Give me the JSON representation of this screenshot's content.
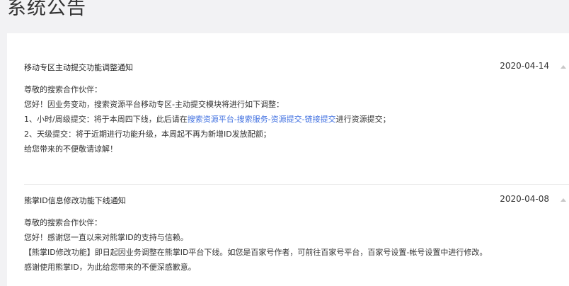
{
  "page": {
    "title": "系统公告"
  },
  "notices": [
    {
      "title": "移动专区主动提交功能调整通知",
      "date": "2020-04-14",
      "lines": {
        "greeting": "尊敬的搜索合作伙伴：",
        "intro": "您好！因业务变动，搜索资源平台移动专区-主动提交模块将进行如下调整：",
        "item1_prefix": "1、小时/周级提交：将于本周四下线，此后请在",
        "item1_link": "搜索资源平台-搜索服务-资源提交-链接提交",
        "item1_suffix": "进行资源提交；",
        "item2": "2、天级提交：将于近期进行功能升级，本周起不再为新增ID发放配额；",
        "closing": "给您带来的不便敬请谅解！"
      }
    },
    {
      "title": "熊掌ID信息修改功能下线通知",
      "date": "2020-04-08",
      "lines": {
        "greeting": "尊敬的搜索合作伙伴：",
        "intro": "您好！感谢您一直以来对熊掌ID的支持与信赖。",
        "detail": "【熊掌ID修改功能】即日起因业务调整在熊掌ID平台下线。如您是百家号作者，可前往百家号平台，百家号设置-帐号设置中进行修改。",
        "closing": "感谢使用熊掌ID，为此给您带来的不便深感歉意。"
      }
    }
  ],
  "colors": {
    "background": "#f2f2f4",
    "panel": "#ffffff",
    "link": "#3f6fe0",
    "text": "#333333"
  },
  "icons": {
    "collapse": "chevron-up-icon"
  }
}
